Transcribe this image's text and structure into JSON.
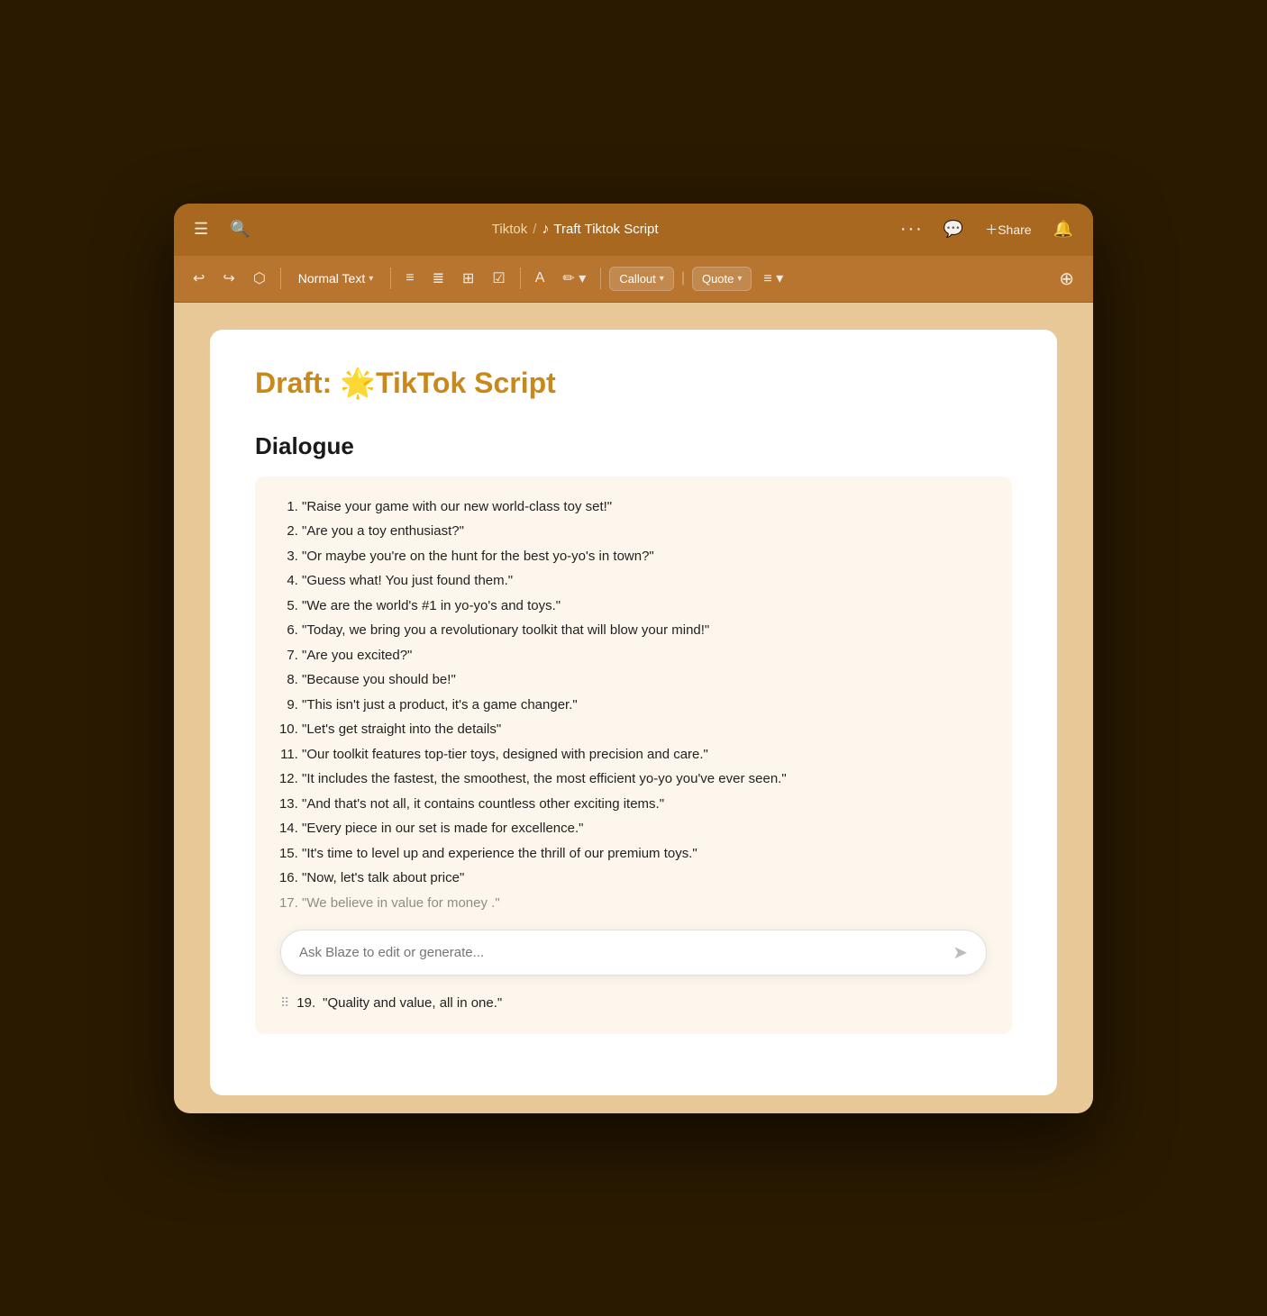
{
  "app": {
    "window_title": "Traft Tiktok Script"
  },
  "topbar": {
    "breadcrumb_parent": "Tiktok",
    "breadcrumb_sep": "/",
    "tiktok_icon": "♪",
    "page_title": "Traft Tiktok Script",
    "more_label": "···",
    "comment_icon": "💬",
    "share_label": "Share",
    "share_icon": "+",
    "notification_icon": "🔔"
  },
  "toolbar": {
    "undo_icon": "↩",
    "redo_icon": "↪",
    "erase_icon": "◇",
    "text_style_label": "Normal Text",
    "bullet_list_icon": "≡",
    "numbered_list_icon": "≡",
    "table_icon": "⊞",
    "check_list_icon": "☑",
    "font_color_icon": "A",
    "highlight_icon": "✏",
    "callout_label": "Callout",
    "quote_label": "Quote",
    "align_icon": "≡",
    "insert_icon": "⊕"
  },
  "document": {
    "title": "Draft: 🌟TikTok Script",
    "section_heading": "Dialogue",
    "dialogue_items": [
      "\"Raise your game with our new world-class toy set!\"",
      "\"Are you a toy enthusiast?\"",
      "\"Or maybe you're on the hunt for the best yo-yo's in town?\"",
      "\"Guess what! You just found them.\"",
      "\"We are the world's #1 in yo-yo's and toys.\"",
      "\"Today, we bring you a revolutionary toolkit that will blow your mind!\"",
      "\"Are you excited?\"",
      "\"Because you should be!\"",
      "\"This isn't just a product, it's a game changer.\"",
      "\"Let's get straight into the details\"",
      "\"Our toolkit features top-tier toys, designed with precision and care.\"",
      "\"It includes the fastest, the smoothest, the most efficient yo-yo you've ever seen.\"",
      "\"And that's not all, it contains countless other exciting items.\"",
      "\"Every piece in our set is made for excellence.\"",
      "\"It's time to level up and experience the thrill of our premium toys.\"",
      "\"Now, let's talk about price\"",
      "\"We believe in value for money .\"",
      null,
      "\"Quality and value, all in one.\""
    ],
    "ai_input_placeholder": "Ask Blaze to edit or generate..."
  }
}
